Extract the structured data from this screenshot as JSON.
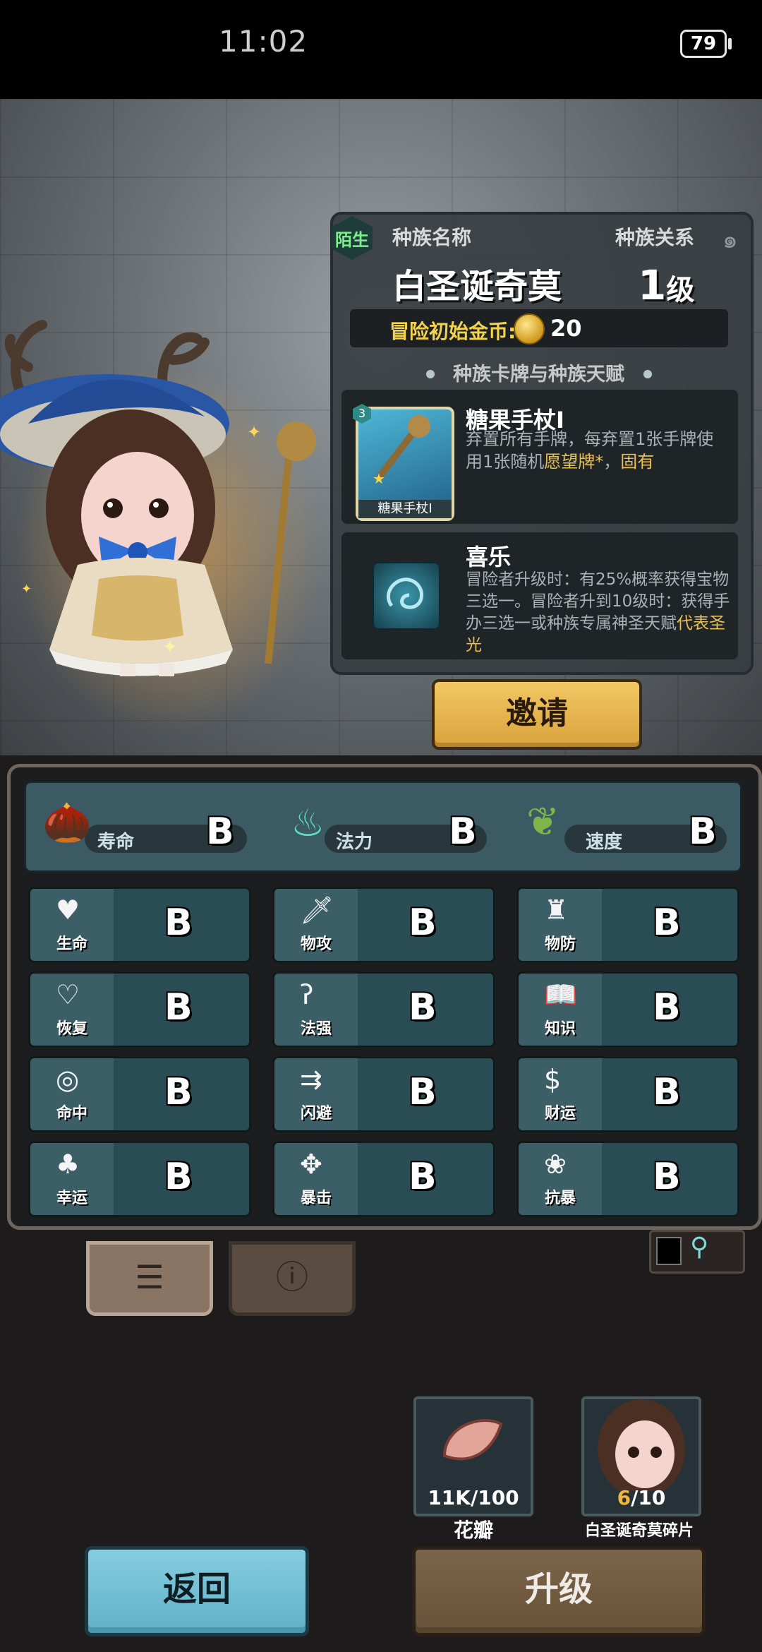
{
  "status_bar": {
    "time": "11:02",
    "battery": "79"
  },
  "race": {
    "badge": "陌生",
    "name_label": "种族名称",
    "relation_label": "种族关系",
    "character_name": "白圣诞奇莫",
    "level_num": "1",
    "level_unit": "级",
    "coin_label": "冒险初始金币:",
    "coin_value": "20",
    "section_title": "种族卡牌与种族天赋"
  },
  "card": {
    "level_badge": "3",
    "caption": "糖果手杖I",
    "title": "糖果手杖I",
    "desc_part1": "弃置所有手牌，每弃置1张手牌使用1张随机",
    "desc_highlight1": "愿望牌*",
    "desc_part2": "，",
    "desc_highlight2": "固有"
  },
  "talent": {
    "title": "喜乐",
    "desc_part1": "冒险者升级时：有25%概率获得宝物三选一。冒险者升到10级时：获得手办三选一或种族专属神圣天赋",
    "desc_highlight": "代表圣光"
  },
  "invite_label": "邀请",
  "big_stats": [
    {
      "label": "寿命",
      "grade": "B",
      "icon": "acorn-head-icon"
    },
    {
      "label": "法力",
      "grade": "B",
      "icon": "spirit-flame-icon"
    },
    {
      "label": "速度",
      "grade": "B",
      "icon": "winged-boot-icon"
    }
  ],
  "stats": [
    {
      "label": "生命",
      "grade": "B",
      "icon": "heart-icon"
    },
    {
      "label": "物攻",
      "grade": "B",
      "icon": "sword-icon"
    },
    {
      "label": "物防",
      "grade": "B",
      "icon": "armor-icon"
    },
    {
      "label": "恢复",
      "grade": "B",
      "icon": "heart-plus-icon"
    },
    {
      "label": "法强",
      "grade": "B",
      "icon": "staff-icon"
    },
    {
      "label": "知识",
      "grade": "B",
      "icon": "book-icon"
    },
    {
      "label": "命中",
      "grade": "B",
      "icon": "target-icon"
    },
    {
      "label": "闪避",
      "grade": "B",
      "icon": "dodge-arrows-icon"
    },
    {
      "label": "财运",
      "grade": "B",
      "icon": "money-bag-icon"
    },
    {
      "label": "幸运",
      "grade": "B",
      "icon": "clover-icon"
    },
    {
      "label": "暴击",
      "grade": "B",
      "icon": "critical-icon"
    },
    {
      "label": "抗暴",
      "grade": "B",
      "icon": "shield-flower-icon"
    }
  ],
  "tabs": [
    {
      "icon": "list-icon",
      "active": true
    },
    {
      "icon": "info-icon",
      "active": false
    }
  ],
  "resources": [
    {
      "name": "花瓣",
      "count": "11K/100",
      "icon": "petal-icon"
    },
    {
      "name": "白圣诞奇莫碎片",
      "count_have": "6",
      "count_total": "/10",
      "icon": "character-fragment-icon"
    }
  ],
  "buttons": {
    "back": "返回",
    "upgrade": "升级"
  }
}
